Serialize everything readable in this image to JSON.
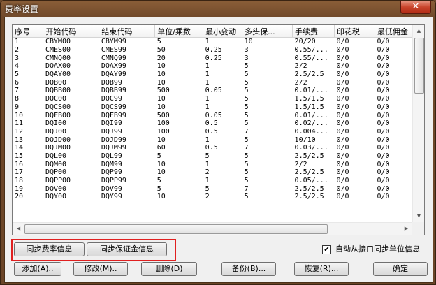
{
  "window": {
    "title": "费率设置",
    "close_symbol": "✕"
  },
  "table": {
    "columns": [
      "序号",
      "开始代码",
      "结束代码",
      "单位/乘数",
      "最小变动",
      "多头保...",
      "手续费",
      "印花税",
      "最低佣金"
    ],
    "rows": [
      [
        "1",
        "CBYM00",
        "CBYM99",
        "5",
        "1",
        "10",
        "20/20",
        "0/0",
        "0/0"
      ],
      [
        "2",
        "CMES00",
        "CMES99",
        "50",
        "0.25",
        "3",
        "0.55/...",
        "0/0",
        "0/0"
      ],
      [
        "3",
        "CMNQ00",
        "CMNQ99",
        "20",
        "0.25",
        "3",
        "0.55/...",
        "0/0",
        "0/0"
      ],
      [
        "4",
        "DQAX00",
        "DQAX99",
        "10",
        "1",
        "5",
        "2/2",
        "0/0",
        "0/0"
      ],
      [
        "5",
        "DQAY00",
        "DQAY99",
        "10",
        "1",
        "5",
        "2.5/2.5",
        "0/0",
        "0/0"
      ],
      [
        "6",
        "DQB00",
        "DQB99",
        "10",
        "1",
        "5",
        "2/2",
        "0/0",
        "0/0"
      ],
      [
        "7",
        "DQBB00",
        "DQBB99",
        "500",
        "0.05",
        "5",
        "0.01/...",
        "0/0",
        "0/0"
      ],
      [
        "8",
        "DQC00",
        "DQC99",
        "10",
        "1",
        "5",
        "1.5/1.5",
        "0/0",
        "0/0"
      ],
      [
        "9",
        "DQCS00",
        "DQCS99",
        "10",
        "1",
        "5",
        "1.5/1.5",
        "0/0",
        "0/0"
      ],
      [
        "10",
        "DQFB00",
        "DQFB99",
        "500",
        "0.05",
        "5",
        "0.01/...",
        "0/0",
        "0/0"
      ],
      [
        "11",
        "DQI00",
        "DQI99",
        "100",
        "0.5",
        "5",
        "0.02/...",
        "0/0",
        "0/0"
      ],
      [
        "12",
        "DQJ00",
        "DQJ99",
        "100",
        "0.5",
        "7",
        "0.004...",
        "0/0",
        "0/0"
      ],
      [
        "13",
        "DQJD00",
        "DQJD99",
        "10",
        "1",
        "5",
        "10/10",
        "0/0",
        "0/0"
      ],
      [
        "14",
        "DQJM00",
        "DQJM99",
        "60",
        "0.5",
        "7",
        "0.03/...",
        "0/0",
        "0/0"
      ],
      [
        "15",
        "DQL00",
        "DQL99",
        "5",
        "5",
        "5",
        "2.5/2.5",
        "0/0",
        "0/0"
      ],
      [
        "16",
        "DQM00",
        "DQM99",
        "10",
        "1",
        "5",
        "2/2",
        "0/0",
        "0/0"
      ],
      [
        "17",
        "DQP00",
        "DQP99",
        "10",
        "2",
        "5",
        "2.5/2.5",
        "0/0",
        "0/0"
      ],
      [
        "18",
        "DQPP00",
        "DQPP99",
        "5",
        "1",
        "5",
        "0.05/...",
        "0/0",
        "0/0"
      ],
      [
        "19",
        "DQV00",
        "DQV99",
        "5",
        "5",
        "7",
        "2.5/2.5",
        "0/0",
        "0/0"
      ],
      [
        "20",
        "DQY00",
        "DQY99",
        "10",
        "2",
        "5",
        "2.5/2.5",
        "0/0",
        "0/0"
      ]
    ]
  },
  "scroll": {
    "up_arrow": "▲",
    "down_arrow": "▼",
    "left_arrow": "◀",
    "right_arrow": "▶",
    "vertical_position": 0.0,
    "horizontal_position": 0.0
  },
  "sync": {
    "fee_button": "同步费率信息",
    "margin_button": "同步保证金信息",
    "auto_sync_label": "自动从接口同步单位信息",
    "auto_sync_checked": true,
    "check_mark": "✔"
  },
  "actions": {
    "add": "添加(A)..",
    "modify": "修改(M)..",
    "delete": "删除(D)",
    "backup": "备份(B)...",
    "restore": "恢复(R)...",
    "ok": "确定"
  }
}
